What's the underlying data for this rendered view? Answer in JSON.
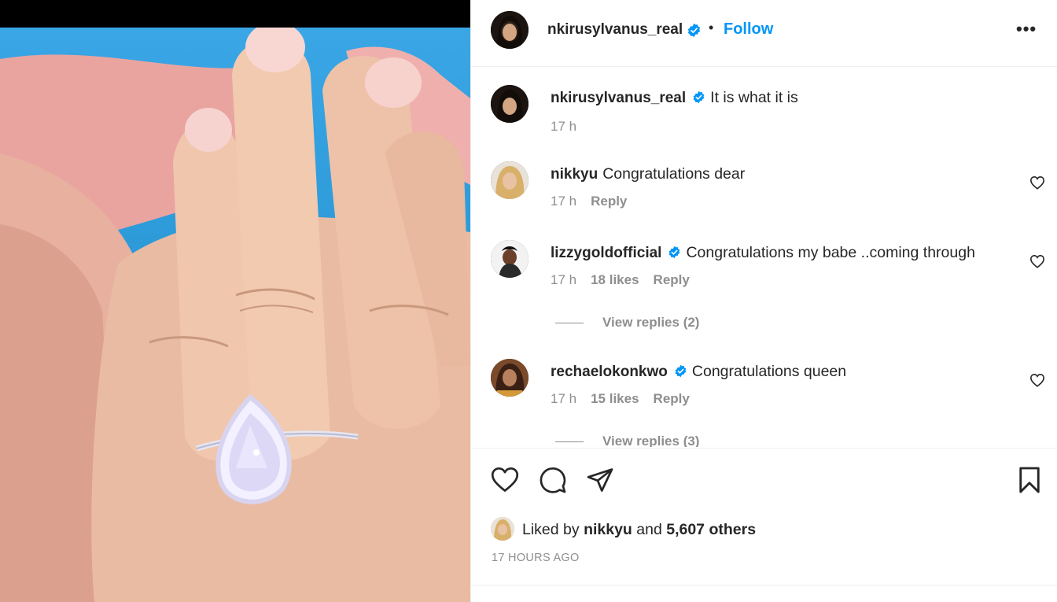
{
  "post": {
    "author": "nkirusylvanus_real",
    "follow_label": "Follow",
    "dot": "•",
    "more": "•••",
    "media_description_icon": "hand-with-ring-photo"
  },
  "caption": {
    "username": "nkirusylvanus_real",
    "text": "It is what it is",
    "time": "17 h"
  },
  "comments": [
    {
      "username": "nikkyu",
      "verified": false,
      "text": "Congratulations dear",
      "time": "17 h",
      "likes": "",
      "reply_label": "Reply"
    },
    {
      "username": "lizzygoldofficial",
      "verified": true,
      "text": "Congratulations my babe ..coming through",
      "time": "17 h",
      "likes": "18 likes",
      "reply_label": "Reply",
      "view_replies": "View replies (2)"
    },
    {
      "username": "rechaelokonkwo",
      "verified": true,
      "text": "Congratulations queen",
      "time": "17 h",
      "likes": "15 likes",
      "reply_label": "Reply",
      "view_replies": "View replies (3)"
    }
  ],
  "actions": {
    "liked_by_prefix": "Liked by",
    "liked_by_user": "nikkyu",
    "and": "and",
    "others": "5,607 others",
    "time_ago": "17 HOURS AGO"
  },
  "colors": {
    "accent": "#0095f6",
    "verified": "#0095f6",
    "secondary_text": "#8e8e8e",
    "photo_bg": "#3aa6e6"
  }
}
